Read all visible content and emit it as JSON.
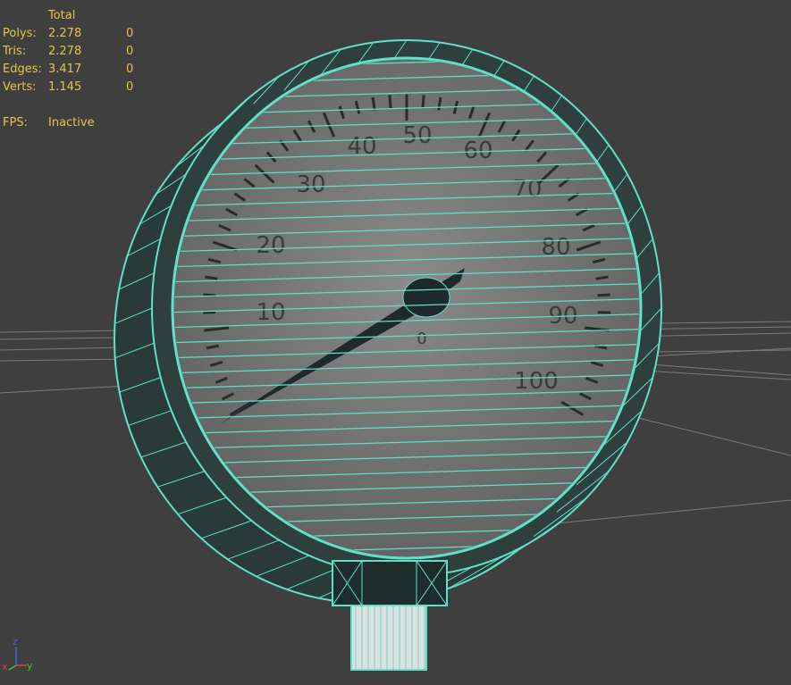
{
  "stats": {
    "header": "Total",
    "rows": [
      {
        "label": "Polys:",
        "total": "2.278",
        "selected": "0"
      },
      {
        "label": "Tris:",
        "total": "2.278",
        "selected": "0"
      },
      {
        "label": "Edges:",
        "total": "3.417",
        "selected": "0"
      },
      {
        "label": "Verts:",
        "total": "1.145",
        "selected": "0"
      }
    ],
    "fps_label": "FPS:",
    "fps_value": "Inactive"
  },
  "gauge": {
    "scale_labels": [
      "10",
      "20",
      "30",
      "40",
      "50",
      "60",
      "70",
      "80",
      "90",
      "100"
    ],
    "center_mark": "0"
  },
  "axis_gizmo": {
    "x_label": "x",
    "y_label": "y",
    "z_label": "z"
  },
  "colors": {
    "background": "#3f3f3f",
    "wireframe": "#5fe0c8",
    "stats_text": "#e6c44a",
    "grid_line": "#8a8a8a",
    "gauge_face": "#777777"
  }
}
